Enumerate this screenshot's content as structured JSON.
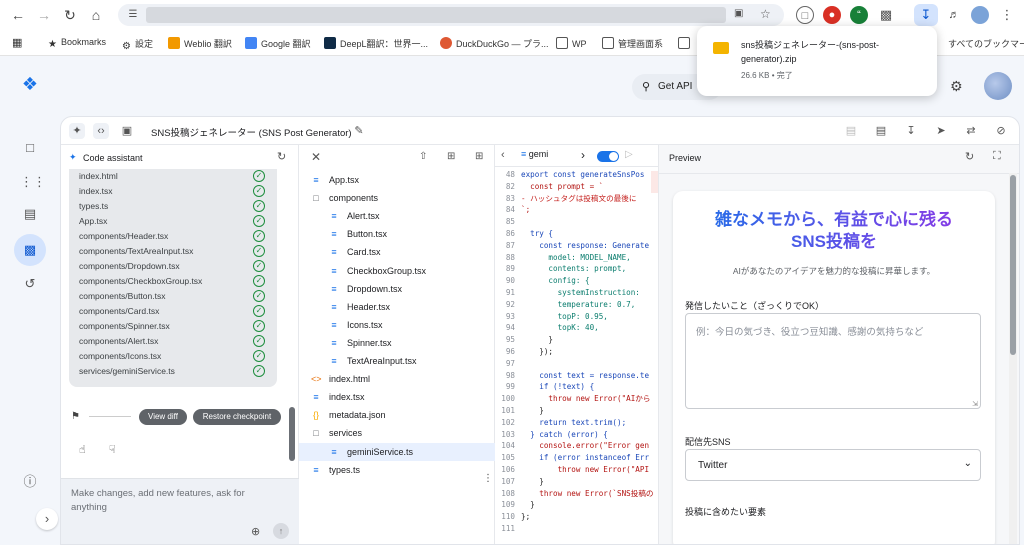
{
  "browser": {
    "bookmarks": [
      {
        "label": "Bookmarks"
      },
      {
        "label": "設定"
      },
      {
        "label": "Weblio 翻訳"
      },
      {
        "label": "Google 翻訳"
      },
      {
        "label": "DeepL翻訳：世界一..."
      },
      {
        "label": "DuckDuckGo — プラ..."
      },
      {
        "label": "WP"
      },
      {
        "label": "管理画面系"
      }
    ],
    "all_bookmarks": "すべてのブックマーク"
  },
  "download": {
    "filename": "sns投稿ジェネレーター-(sns-post-generator).zip",
    "status": "26.6 KB • 完了"
  },
  "header": {
    "get_api_label": "Get API"
  },
  "workspace": {
    "project_title": "SNS投稿ジェネレーター (SNS Post Generator)"
  },
  "assistant": {
    "title": "Code assistant",
    "files": [
      "index.html",
      "index.tsx",
      "types.ts",
      "App.tsx",
      "components/Header.tsx",
      "components/TextAreaInput.tsx",
      "components/Dropdown.tsx",
      "components/CheckboxGroup.tsx",
      "components/Button.tsx",
      "components/Card.tsx",
      "components/Spinner.tsx",
      "components/Alert.tsx",
      "components/Icons.tsx",
      "services/geminiService.ts"
    ],
    "view_diff": "View diff",
    "restore_checkpoint": "Restore checkpoint",
    "composer_placeholder": "Make changes, add new features, ask for anything"
  },
  "filetree": {
    "rows": [
      {
        "label": "App.tsx",
        "icon": "file-icon",
        "depth": 0
      },
      {
        "label": "components",
        "icon": "folder-icon",
        "depth": 0
      },
      {
        "label": "Alert.tsx",
        "icon": "file-icon",
        "depth": 1
      },
      {
        "label": "Button.tsx",
        "icon": "file-icon",
        "depth": 1
      },
      {
        "label": "Card.tsx",
        "icon": "file-icon",
        "depth": 1
      },
      {
        "label": "CheckboxGroup.tsx",
        "icon": "file-icon",
        "depth": 1
      },
      {
        "label": "Dropdown.tsx",
        "icon": "file-icon",
        "depth": 1
      },
      {
        "label": "Header.tsx",
        "icon": "file-icon",
        "depth": 1
      },
      {
        "label": "Icons.tsx",
        "icon": "file-icon",
        "depth": 1
      },
      {
        "label": "Spinner.tsx",
        "icon": "file-icon",
        "depth": 1
      },
      {
        "label": "TextAreaInput.tsx",
        "icon": "file-icon",
        "depth": 1
      },
      {
        "label": "index.html",
        "icon": "html-icon",
        "depth": 0
      },
      {
        "label": "index.tsx",
        "icon": "file-icon",
        "depth": 0
      },
      {
        "label": "metadata.json",
        "icon": "json-icon",
        "depth": 0
      },
      {
        "label": "services",
        "icon": "folder-icon",
        "depth": 0
      },
      {
        "label": "geminiService.ts",
        "icon": "file-icon",
        "depth": 1,
        "selected": true
      },
      {
        "label": "types.ts",
        "icon": "file-icon",
        "depth": 0
      }
    ]
  },
  "editor": {
    "tab_label": "gemi",
    "lines": [
      {
        "n": "48",
        "t": "export const generateSnsPos"
      },
      {
        "n": "82",
        "t": "  const prompt = `"
      },
      {
        "n": "83",
        "t": "- ハッシュタグは投稿文の最後に"
      },
      {
        "n": "84",
        "t": "`;"
      },
      {
        "n": "85",
        "t": ""
      },
      {
        "n": "86",
        "t": "  try {"
      },
      {
        "n": "87",
        "t": "    const response: Generate"
      },
      {
        "n": "88",
        "t": "      model: MODEL_NAME,"
      },
      {
        "n": "89",
        "t": "      contents: prompt,"
      },
      {
        "n": "90",
        "t": "      config: {"
      },
      {
        "n": "91",
        "t": "        systemInstruction:"
      },
      {
        "n": "92",
        "t": "        temperature: 0.7,"
      },
      {
        "n": "93",
        "t": "        topP: 0.95,"
      },
      {
        "n": "94",
        "t": "        topK: 40,"
      },
      {
        "n": "95",
        "t": "      }"
      },
      {
        "n": "96",
        "t": "    });"
      },
      {
        "n": "97",
        "t": ""
      },
      {
        "n": "98",
        "t": "    const text = response.te"
      },
      {
        "n": "99",
        "t": "    if (!text) {"
      },
      {
        "n": "100",
        "t": "      throw new Error(\"AIから"
      },
      {
        "n": "101",
        "t": "    }"
      },
      {
        "n": "102",
        "t": "    return text.trim();"
      },
      {
        "n": "103",
        "t": "  } catch (error) {"
      },
      {
        "n": "104",
        "t": "    console.error(\"Error gen"
      },
      {
        "n": "105",
        "t": "    if (error instanceof Err"
      },
      {
        "n": "106",
        "t": "        throw new Error(\"API"
      },
      {
        "n": "107",
        "t": "    }"
      },
      {
        "n": "108",
        "t": "    throw new Error(`SNS投稿の"
      },
      {
        "n": "109",
        "t": "  }"
      },
      {
        "n": "110",
        "t": "};"
      },
      {
        "n": "111",
        "t": ""
      }
    ]
  },
  "preview": {
    "panel_title": "Preview",
    "title_line1": "雑なメモから、有益で心に残る",
    "title_line2": "SNS投稿を",
    "subtitle": "AIがあなたのアイデアを魅力的な投稿に昇華します。",
    "memo_label": "発信したいこと（ざっくりでOK）",
    "memo_placeholder": "例：今日の気づき、役立つ豆知識、感謝の気持ちなど",
    "target_label": "配信先SNS",
    "target_value": "Twitter",
    "elements_label": "投稿に含めたい要素"
  },
  "colors": {
    "accent": "#1a73e8",
    "check": "#1e8e3e",
    "gradient_end": "#9334e6"
  }
}
